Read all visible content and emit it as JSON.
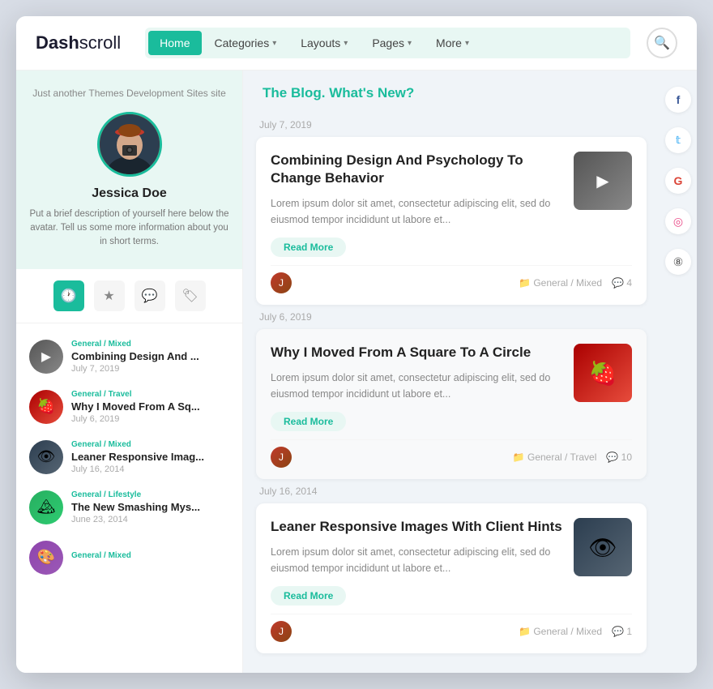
{
  "header": {
    "logo_bold": "Dash",
    "logo_light": "scroll",
    "nav_items": [
      {
        "label": "Home",
        "active": true,
        "has_chevron": false
      },
      {
        "label": "Categories",
        "active": false,
        "has_chevron": true
      },
      {
        "label": "Layouts",
        "active": false,
        "has_chevron": true
      },
      {
        "label": "Pages",
        "active": false,
        "has_chevron": true
      },
      {
        "label": "More",
        "active": false,
        "has_chevron": true
      }
    ]
  },
  "sidebar": {
    "tagline": "Just another Themes Development Sites site",
    "user_name": "Jessica Doe",
    "user_desc": "Put a brief description of yourself here below the avatar. Tell us some more information about you in short terms.",
    "tabs": [
      {
        "icon": "🕐",
        "active": true
      },
      {
        "icon": "★",
        "active": false
      },
      {
        "icon": "💬",
        "active": false
      },
      {
        "icon": "🏷",
        "active": false
      }
    ],
    "recent_posts": [
      {
        "category": "General / Mixed",
        "title": "Combining Design And ...",
        "date": "July 7, 2019",
        "thumb_type": "camera"
      },
      {
        "category": "General / Travel",
        "title": "Why I Moved From A Sq...",
        "date": "July 6, 2019",
        "thumb_type": "strawberry"
      },
      {
        "category": "General / Mixed",
        "title": "Leaner Responsive Imag...",
        "date": "July 16, 2014",
        "thumb_type": "eye"
      },
      {
        "category": "General / Lifestyle",
        "title": "The New Smashing Mys...",
        "date": "June 23, 2014",
        "thumb_type": "mountain"
      },
      {
        "category": "General / Mixed",
        "title": "",
        "date": "",
        "thumb_type": "more"
      }
    ]
  },
  "blog": {
    "heading_static": "The Blog.",
    "heading_dynamic": "What's New?",
    "posts": [
      {
        "date_label": "July 7, 2019",
        "title": "Combining Design And Psychology To Change Behavior",
        "excerpt": "Lorem ipsum dolor sit amet, consectetur adipiscing elit, sed do eiusmod tempor incididunt ut labore et...",
        "read_more": "Read More",
        "category": "General / Mixed",
        "comments": "4",
        "thumb_type": "camera"
      },
      {
        "date_label": "July 6, 2019",
        "title": "Why I Moved From A Square To A Circle",
        "excerpt": "Lorem ipsum dolor sit amet, consectetur adipiscing elit, sed do eiusmod tempor incididunt ut labore et...",
        "read_more": "Read More",
        "category": "General / Travel",
        "comments": "10",
        "thumb_type": "strawberry"
      },
      {
        "date_label": "July 16, 2014",
        "title": "Leaner Responsive Images With Client Hints",
        "excerpt": "Lorem ipsum dolor sit amet, consectetur adipiscing elit, sed do eiusmod tempor incididunt ut labore et...",
        "read_more": "Read More",
        "category": "General / Mixed",
        "comments": "1",
        "thumb_type": "eye"
      }
    ]
  },
  "social": [
    {
      "icon": "f",
      "name": "facebook"
    },
    {
      "icon": "t",
      "name": "twitter"
    },
    {
      "icon": "G",
      "name": "google"
    },
    {
      "icon": "◎",
      "name": "dribbble"
    },
    {
      "icon": "⑧",
      "name": "other"
    }
  ],
  "colors": {
    "accent": "#1abc9c",
    "text_dark": "#222",
    "text_mid": "#888",
    "text_light": "#aaa",
    "bg_light": "#f0f4f8",
    "bg_teal_light": "#e8f7f3"
  }
}
